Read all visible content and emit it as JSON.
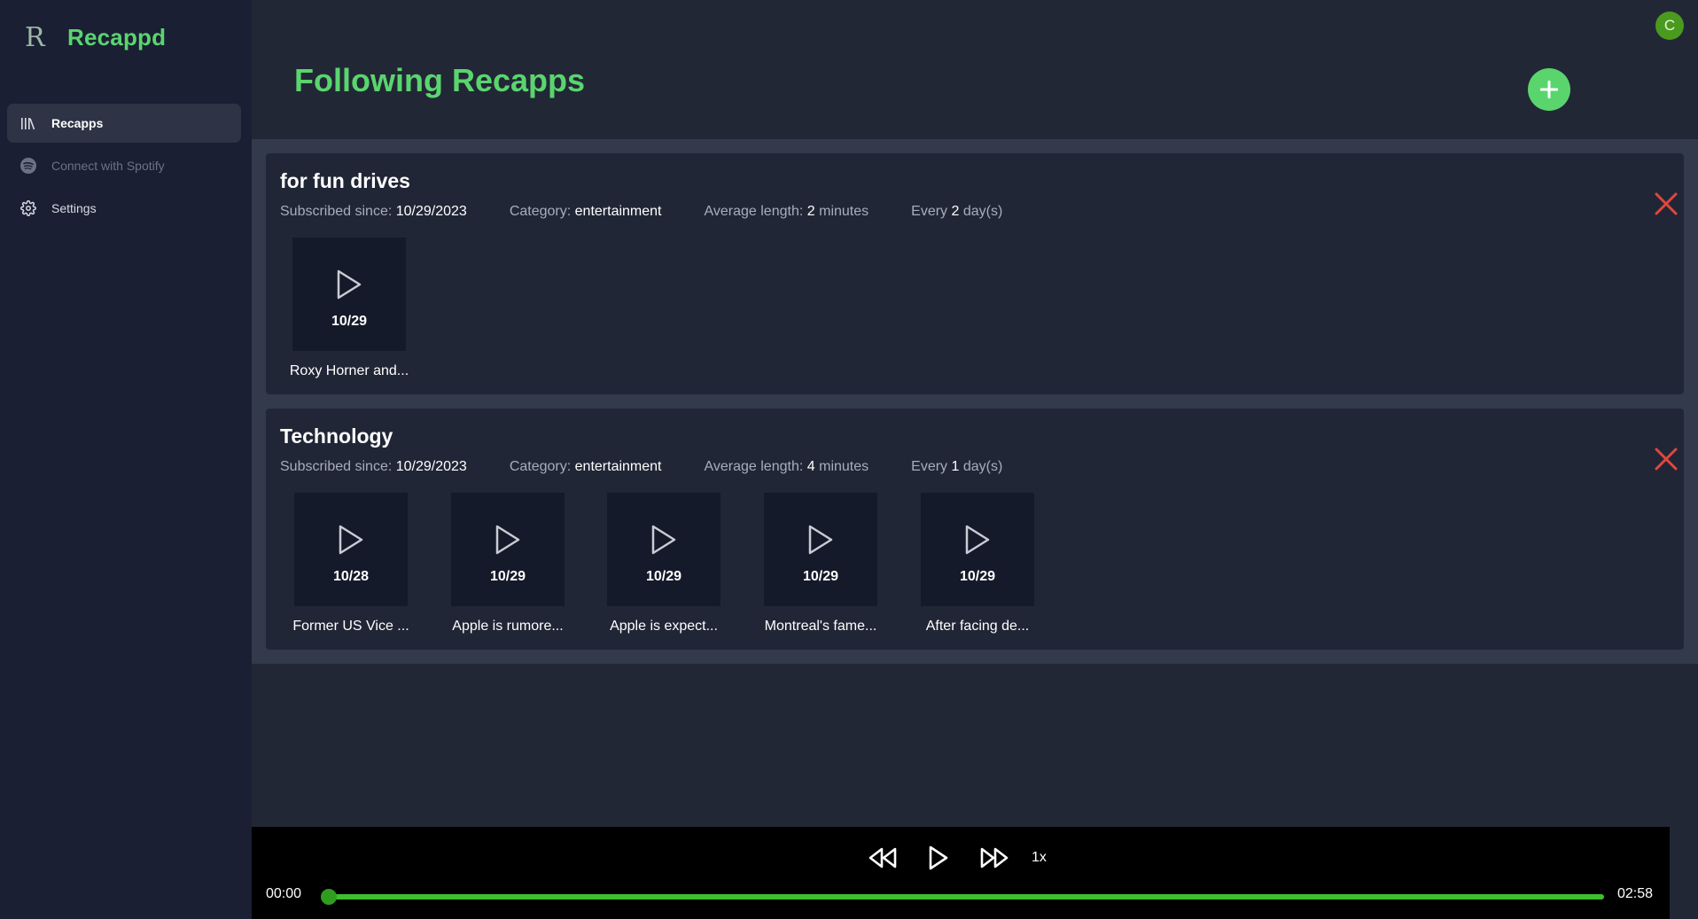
{
  "app": {
    "name": "Recappd"
  },
  "sidebar": {
    "items": [
      {
        "label": "Recapps",
        "icon": "library-icon",
        "active": true
      },
      {
        "label": "Connect with Spotify",
        "icon": "spotify-icon",
        "disabled": true
      },
      {
        "label": "Settings",
        "icon": "gear-icon"
      }
    ]
  },
  "header": {
    "title": "Following Recapps",
    "avatar_initial": "C"
  },
  "labels": {
    "subscribed_since": "Subscribed since:",
    "category": "Category:",
    "average_length": "Average length:",
    "minutes": "minutes",
    "every": "Every",
    "days": "day(s)"
  },
  "recapps": [
    {
      "title": "for fun drives",
      "subscribed_since": "10/29/2023",
      "category": "entertainment",
      "average_length": "2",
      "every": "2",
      "episodes": [
        {
          "date": "10/29",
          "title": "Roxy Horner and..."
        }
      ]
    },
    {
      "title": "Technology",
      "subscribed_since": "10/29/2023",
      "category": "entertainment",
      "average_length": "4",
      "every": "1",
      "episodes": [
        {
          "date": "10/28",
          "title": "Former US Vice ..."
        },
        {
          "date": "10/29",
          "title": "Apple is rumore..."
        },
        {
          "date": "10/29",
          "title": "Apple is expect..."
        },
        {
          "date": "10/29",
          "title": "Montreal's fame..."
        },
        {
          "date": "10/29",
          "title": "After facing de..."
        }
      ]
    }
  ],
  "player": {
    "current_time": "00:00",
    "duration": "02:58",
    "speed": "1x",
    "progress": 0
  },
  "colors": {
    "accent": "#5ad56e",
    "sidebar_bg": "#1a1f33",
    "main_bg": "#222736",
    "close": "#e0473c",
    "progress": "#3fbf2f"
  }
}
